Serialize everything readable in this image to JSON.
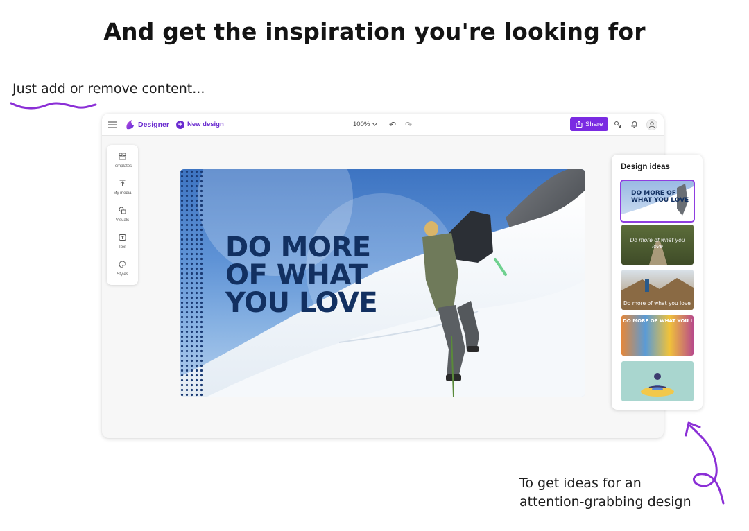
{
  "heading": "And get the inspiration you're looking for",
  "annotations": {
    "left": "Just add or remove content...",
    "right_line1": "To get ideas for an",
    "right_line2": "attention-grabbing design"
  },
  "toolbar": {
    "brand": "Designer",
    "new_design": "New design",
    "zoom": "100%",
    "share": "Share"
  },
  "rail": {
    "items": [
      {
        "label": "Templates",
        "icon": "templates-icon"
      },
      {
        "label": "My media",
        "icon": "upload-icon"
      },
      {
        "label": "Visuals",
        "icon": "shapes-icon"
      },
      {
        "label": "Text",
        "icon": "text-icon"
      },
      {
        "label": "Styles",
        "icon": "palette-icon"
      }
    ]
  },
  "canvas": {
    "headline": [
      "DO MORE",
      "OF WHAT",
      "YOU LOVE"
    ]
  },
  "design_ideas": {
    "title": "Design ideas",
    "thumbnails": [
      {
        "text": "DO MORE OF WHAT YOU LOVE",
        "selected": true
      },
      {
        "text": "Do more of what you love"
      },
      {
        "text": "Do more of what you love"
      },
      {
        "text": "DO MORE OF WHAT YOU LOVE"
      },
      {
        "text": ""
      }
    ]
  },
  "colors": {
    "accent": "#7a2be2",
    "headline": "#123061",
    "squiggle": "#8b2fd6"
  }
}
